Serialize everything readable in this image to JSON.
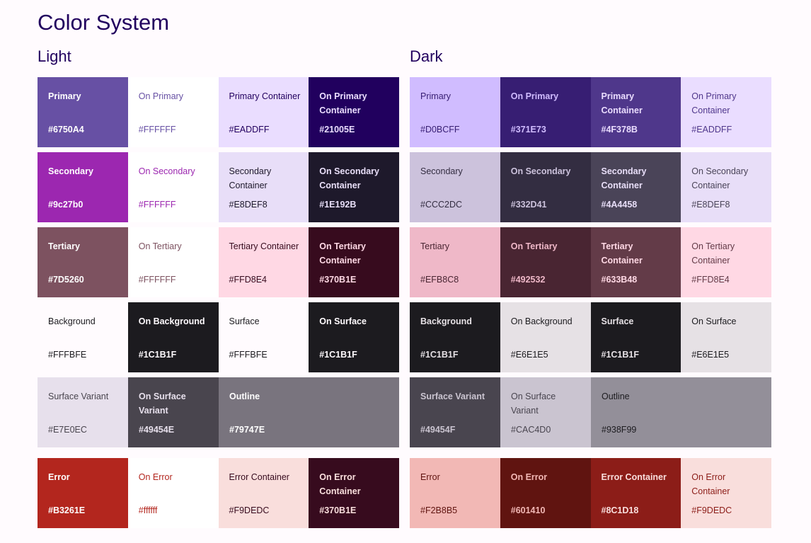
{
  "title": "Color System",
  "themes": [
    {
      "key": "light",
      "label": "Light",
      "rows": [
        [
          {
            "name": "Primary",
            "hex": "#6750A4",
            "bg": "#6750A4",
            "fg": "#FFFFFF",
            "bold": true
          },
          {
            "name": "On Primary",
            "hex": "#FFFFFF",
            "bg": "#FFFFFF",
            "fg": "#6750A4",
            "bold": false
          },
          {
            "name": "Primary Container",
            "hex": "#EADDFF",
            "bg": "#EADDFF",
            "fg": "#21005E",
            "bold": false
          },
          {
            "name": "On Primary Container",
            "hex": "#21005E",
            "bg": "#21005E",
            "fg": "#EADDFF",
            "bold": true
          }
        ],
        [
          {
            "name": "Secondary",
            "hex": "#9c27b0",
            "bg": "#9C27B0",
            "fg": "#FFFFFF",
            "bold": true
          },
          {
            "name": "On Secondary",
            "hex": "#FFFFFF",
            "bg": "#FFFFFF",
            "fg": "#9C27B0",
            "bold": false
          },
          {
            "name": "Secondary Container",
            "hex": "#E8DEF8",
            "bg": "#E8DEF8",
            "fg": "#1E192B",
            "bold": false
          },
          {
            "name": "On Secondary Container",
            "hex": "#1E192B",
            "bg": "#1E192B",
            "fg": "#E8DEF8",
            "bold": true
          }
        ],
        [
          {
            "name": "Tertiary",
            "hex": "#7D5260",
            "bg": "#7D5260",
            "fg": "#FFFFFF",
            "bold": true
          },
          {
            "name": "On Tertiary",
            "hex": "#FFFFFF",
            "bg": "#FFFFFF",
            "fg": "#7D5260",
            "bold": false
          },
          {
            "name": "Tertiary Container",
            "hex": "#FFD8E4",
            "bg": "#FFD8E4",
            "fg": "#370B1E",
            "bold": false
          },
          {
            "name": "On Tertiary Container",
            "hex": "#370B1E",
            "bg": "#370B1E",
            "fg": "#FFD8E4",
            "bold": true
          }
        ],
        [
          {
            "name": "Background",
            "hex": "#FFFBFE",
            "bg": "#FFFBFE",
            "fg": "#1C1B1F",
            "bold": false
          },
          {
            "name": "On Background",
            "hex": "#1C1B1F",
            "bg": "#1C1B1F",
            "fg": "#FFFBFE",
            "bold": true
          },
          {
            "name": "Surface",
            "hex": "#FFFBFE",
            "bg": "#FFFBFE",
            "fg": "#1C1B1F",
            "bold": false
          },
          {
            "name": "On Surface",
            "hex": "#1C1B1F",
            "bg": "#1C1B1F",
            "fg": "#FFFBFE",
            "bold": true
          }
        ],
        [
          {
            "name": "Surface Variant",
            "hex": "#E7E0EC",
            "bg": "#E7E0EC",
            "fg": "#49454E",
            "bold": false
          },
          {
            "name": "On Surface Variant",
            "hex": "#49454E",
            "bg": "#49454E",
            "fg": "#E7E0EC",
            "bold": true
          },
          {
            "name": "Outline",
            "hex": "#79747E",
            "bg": "#79747E",
            "fg": "#FFFFFF",
            "bold": true,
            "span": 2
          }
        ],
        [
          {
            "name": "Error",
            "hex": "#B3261E",
            "bg": "#B3261E",
            "fg": "#FFFFFF",
            "bold": true
          },
          {
            "name": "On Error",
            "hex": "#ffffff",
            "bg": "#FFFFFF",
            "fg": "#B3261E",
            "bold": false
          },
          {
            "name": "Error Container",
            "hex": "#F9DEDC",
            "bg": "#F9DEDC",
            "fg": "#370B1E",
            "bold": false
          },
          {
            "name": "On Error Container",
            "hex": "#370B1E",
            "bg": "#370B1E",
            "fg": "#F9DEDC",
            "bold": true
          }
        ]
      ]
    },
    {
      "key": "dark",
      "label": "Dark",
      "rows": [
        [
          {
            "name": "Primary",
            "hex": "#D0BCFF",
            "bg": "#D0BCFF",
            "fg": "#371E73",
            "bold": false
          },
          {
            "name": "On Primary",
            "hex": "#371E73",
            "bg": "#371E73",
            "fg": "#D0BCFF",
            "bold": true
          },
          {
            "name": "Primary Container",
            "hex": "#4F378B",
            "bg": "#4F378B",
            "fg": "#EADDFF",
            "bold": true
          },
          {
            "name": "On Primary Container",
            "hex": "#EADDFF",
            "bg": "#EADDFF",
            "fg": "#4F378B",
            "bold": false
          }
        ],
        [
          {
            "name": "Secondary",
            "hex": "#CCC2DC",
            "bg": "#CCC2DC",
            "fg": "#332D41",
            "bold": false
          },
          {
            "name": "On Secondary",
            "hex": "#332D41",
            "bg": "#332D41",
            "fg": "#CCC2DC",
            "bold": true
          },
          {
            "name": "Secondary Container",
            "hex": "#4A4458",
            "bg": "#4A4458",
            "fg": "#E8DEF8",
            "bold": true
          },
          {
            "name": "On Secondary Container",
            "hex": "#E8DEF8",
            "bg": "#E8DEF8",
            "fg": "#4A4458",
            "bold": false
          }
        ],
        [
          {
            "name": "Tertiary",
            "hex": "#EFB8C8",
            "bg": "#EFB8C8",
            "fg": "#492532",
            "bold": false
          },
          {
            "name": "On Tertiary",
            "hex": "#492532",
            "bg": "#492532",
            "fg": "#EFB8C8",
            "bold": true
          },
          {
            "name": "Tertiary Container",
            "hex": "#633B48",
            "bg": "#633B48",
            "fg": "#FFD8E4",
            "bold": true
          },
          {
            "name": "On Tertiary Container",
            "hex": "#FFD8E4",
            "bg": "#FFD8E4",
            "fg": "#633B48",
            "bold": false
          }
        ],
        [
          {
            "name": "Background",
            "hex": "#1C1B1F",
            "bg": "#1C1B1F",
            "fg": "#E6E1E5",
            "bold": true
          },
          {
            "name": "On Background",
            "hex": "#E6E1E5",
            "bg": "#E6E1E5",
            "fg": "#1C1B1F",
            "bold": false
          },
          {
            "name": "Surface",
            "hex": "#1C1B1F",
            "bg": "#1C1B1F",
            "fg": "#E6E1E5",
            "bold": true
          },
          {
            "name": "On Surface",
            "hex": "#E6E1E5",
            "bg": "#E6E1E5",
            "fg": "#1C1B1F",
            "bold": false
          }
        ],
        [
          {
            "name": "Surface Variant",
            "hex": "#49454F",
            "bg": "#49454F",
            "fg": "#CAC4D0",
            "bold": true
          },
          {
            "name": "On Surface Variant",
            "hex": "#CAC4D0",
            "bg": "#CAC4D0",
            "fg": "#49454F",
            "bold": false
          },
          {
            "name": "Outline",
            "hex": "#938F99",
            "bg": "#938F99",
            "fg": "#1C1B1F",
            "bold": false,
            "span": 2
          }
        ],
        [
          {
            "name": "Error",
            "hex": "#F2B8B5",
            "bg": "#F2B8B5",
            "fg": "#601410",
            "bold": false
          },
          {
            "name": "On Error",
            "hex": "#601410",
            "bg": "#601410",
            "fg": "#F2B8B5",
            "bold": true
          },
          {
            "name": "Error Container",
            "hex": "#8C1D18",
            "bg": "#8C1D18",
            "fg": "#F9DEDC",
            "bold": true
          },
          {
            "name": "On Error Container",
            "hex": "#F9DEDC",
            "bg": "#F9DEDC",
            "fg": "#8C1D18",
            "bold": false
          }
        ]
      ]
    }
  ]
}
